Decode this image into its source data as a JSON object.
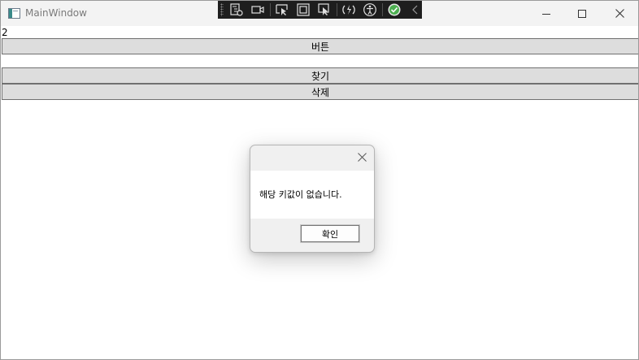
{
  "window": {
    "title": "MainWindow"
  },
  "debug_toolbar": {
    "icons": [
      "visual-tree-icon",
      "record-icon",
      "select-element-icon",
      "display-layout-adorners-icon",
      "track-focus-icon",
      "hot-reload-icon",
      "accessibility-icon",
      "binding-check-icon",
      "collapse-chevron-icon"
    ]
  },
  "main": {
    "counter": "2",
    "button_label": "버튼",
    "find_label": "찾기",
    "delete_label": "삭제"
  },
  "dialog": {
    "message": "해당 키값이 없습니다.",
    "ok_label": "확인"
  },
  "colors": {
    "button_bg": "#dddddd",
    "check_green": "#4caf50"
  }
}
